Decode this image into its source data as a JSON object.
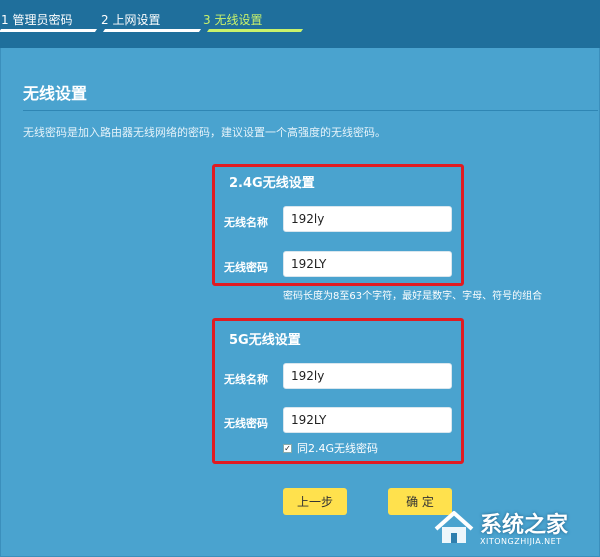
{
  "steps": [
    {
      "label": "1 管理员密码"
    },
    {
      "label": "2 上网设置"
    },
    {
      "label": "3 无线设置"
    }
  ],
  "page": {
    "title": "无线设置",
    "description": "无线密码是加入路由器无线网络的密码，建议设置一个高强度的无线密码。"
  },
  "band24": {
    "title": "2.4G无线设置",
    "name_label": "无线名称",
    "name_value": "192ly",
    "password_label": "无线密码",
    "password_value": "192LY",
    "hint": "密码长度为8至63个字符，最好是数字、字母、符号的组合"
  },
  "band5": {
    "title": "5G无线设置",
    "name_label": "无线名称",
    "name_value": "192ly",
    "password_label": "无线密码",
    "password_value": "192LY",
    "same_password_label": "同2.4G无线密码",
    "same_password_checked": true
  },
  "buttons": {
    "prev_label": "上一步",
    "confirm_label": "确 定"
  },
  "watermark": {
    "text": "系统之家",
    "url": "XITONGZHIJIA.NET"
  },
  "colors": {
    "background": "#4aa3cf",
    "steps_bar": "#1f6f9c",
    "active_step": "#c9f26b",
    "highlight": "#e01b22",
    "button": "#ffe14d"
  }
}
